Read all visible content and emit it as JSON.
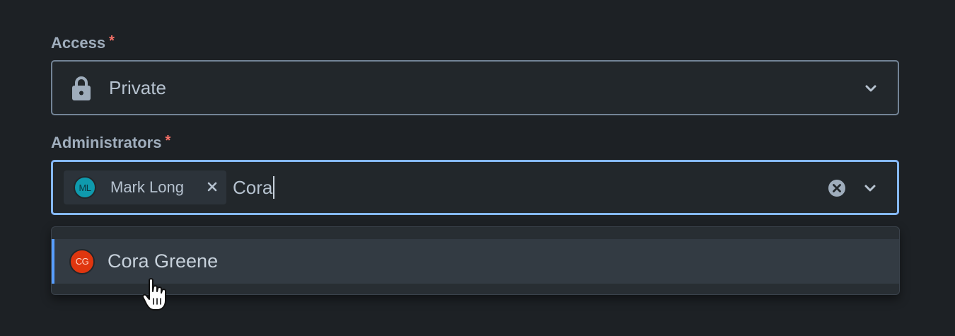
{
  "access": {
    "label": "Access",
    "required_mark": "*",
    "value": "Private",
    "icon": "lock-icon"
  },
  "administrators": {
    "label": "Administrators",
    "required_mark": "*",
    "selected": [
      {
        "initials": "ML",
        "name": "Mark Long",
        "avatar_color": "#0f9aad"
      }
    ],
    "search_value": "Cora",
    "options": [
      {
        "initials": "CG",
        "name": "Cora Greene",
        "avatar_color": "#e0360f",
        "highlighted": true
      }
    ]
  },
  "colors": {
    "background": "#1d2125",
    "focus_border": "#85b8ff",
    "required": "#f87168",
    "highlight_bar": "#579dff"
  }
}
